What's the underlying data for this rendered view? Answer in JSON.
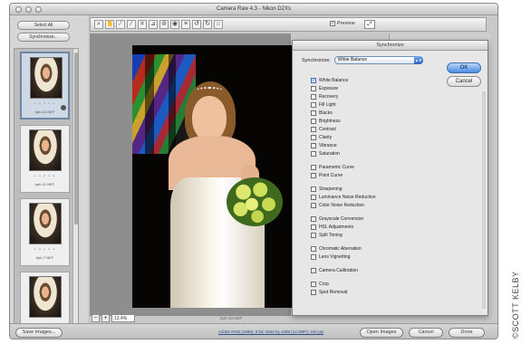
{
  "window": {
    "title": "Camera Raw 4.3 - Nikon D2Xs"
  },
  "left_panel": {
    "select_all_label": "Select All",
    "synchronize_label": "Synchronize..."
  },
  "filmstrip": {
    "thumbnails": [
      {
        "name": "bph-10.NEF",
        "stars": "• • • • •",
        "selected": true
      },
      {
        "name": "bph-11.NEF",
        "stars": "• • • • •",
        "selected": false
      },
      {
        "name": "bph-7.NEF",
        "stars": "• • • • •",
        "selected": false
      },
      {
        "name": "",
        "stars": "",
        "selected": false
      }
    ]
  },
  "toolbar": {
    "preview_label": "Preview",
    "preview_checked": "✓"
  },
  "zoom": {
    "value": "13.4%",
    "minus": "−",
    "plus": "+"
  },
  "image_caption": "bph-10.NEF",
  "bottom_bar": {
    "save_label": "Save Images...",
    "info_link": "Adobe RGB (1998); 8 bit; 2848 by 4288 (12.2MP); 240 ppi",
    "open_label": "Open Images",
    "cancel_label": "Cancel",
    "done_label": "Done"
  },
  "dialog": {
    "title": "Synchronize",
    "sync_label": "Synchronize:",
    "sync_value": "White Balance",
    "ok_label": "OK",
    "cancel_label": "Cancel",
    "items": [
      {
        "label": "White Balance",
        "checked": true
      },
      {
        "label": "Exposure",
        "checked": false
      },
      {
        "label": "Recovery",
        "checked": false
      },
      {
        "label": "Fill Light",
        "checked": false
      },
      {
        "label": "Blacks",
        "checked": false
      },
      {
        "label": "Brightness",
        "checked": false
      },
      {
        "label": "Contrast",
        "checked": false
      },
      {
        "label": "Clarity",
        "checked": false
      },
      {
        "label": "Vibrance",
        "checked": false
      },
      {
        "label": "Saturation",
        "checked": false
      },
      {
        "label": "Parametric Curve",
        "checked": false
      },
      {
        "label": "Point Curve",
        "checked": false
      },
      {
        "label": "Sharpening",
        "checked": false
      },
      {
        "label": "Luminance Noise Reduction",
        "checked": false
      },
      {
        "label": "Color Noise Reduction",
        "checked": false
      },
      {
        "label": "Grayscale Conversion",
        "checked": false
      },
      {
        "label": "HSL Adjustments",
        "checked": false
      },
      {
        "label": "Split Toning",
        "checked": false
      },
      {
        "label": "Chromatic Aberration",
        "checked": false
      },
      {
        "label": "Lens Vignetting",
        "checked": false
      },
      {
        "label": "Camera Calibration",
        "checked": false
      },
      {
        "label": "Crop",
        "checked": false
      },
      {
        "label": "Spot Removal",
        "checked": false
      }
    ]
  },
  "credit": "©SCOTT KELBY",
  "colors": {
    "accent": "#4a8ae0",
    "panel": "#c9c9c9"
  }
}
